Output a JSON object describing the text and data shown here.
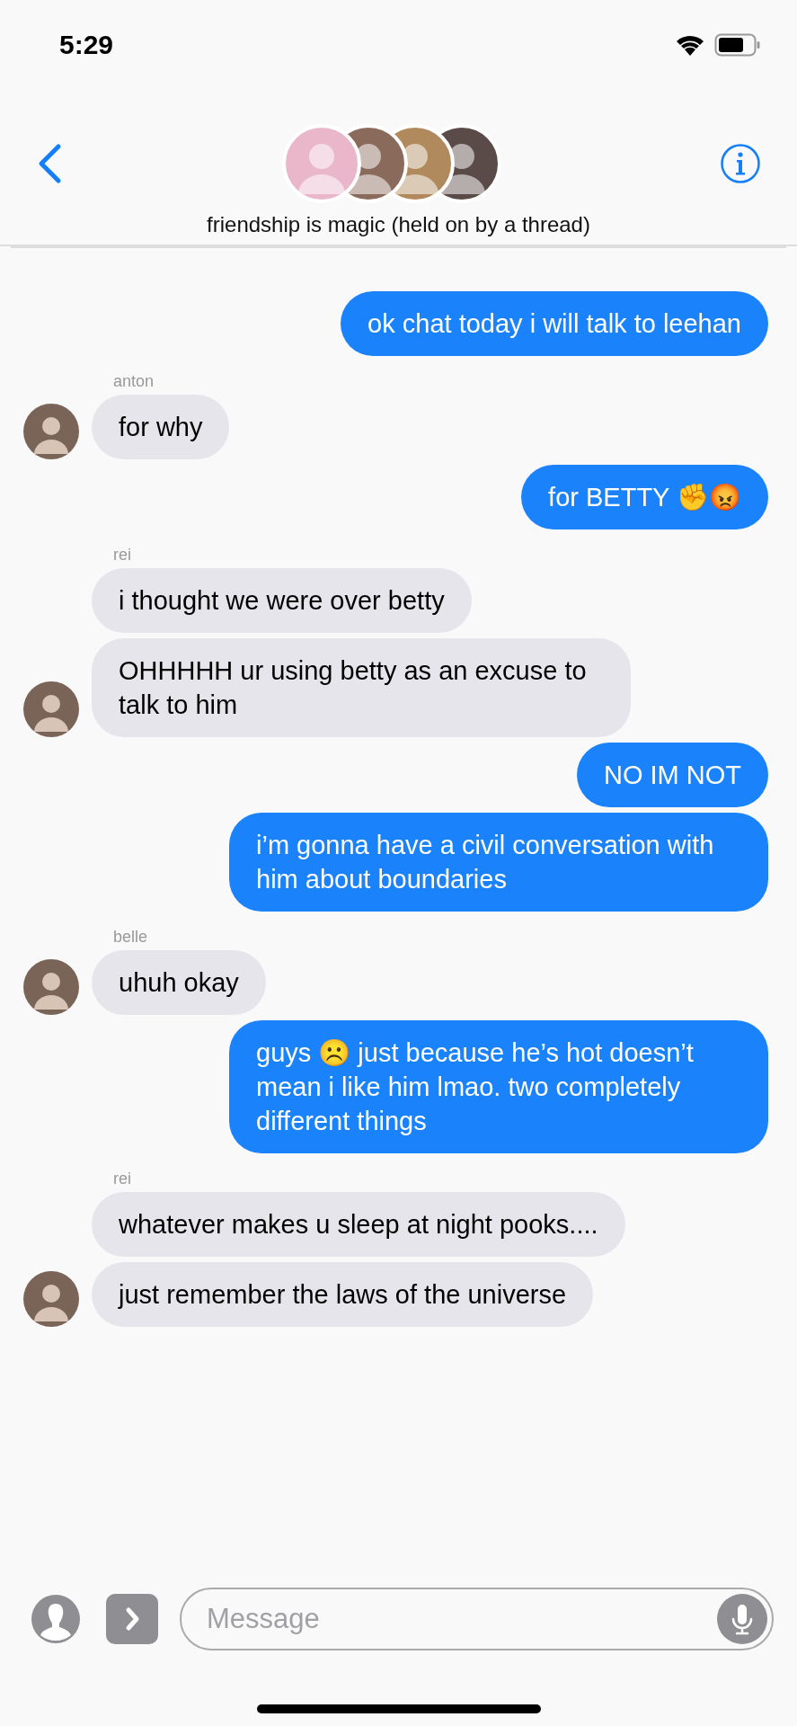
{
  "status_bar": {
    "time": "5:29"
  },
  "header": {
    "title": "friendship is magic (held on by a thread)"
  },
  "messages": [
    {
      "kind": "sent",
      "text": "ok chat today i will talk to leehan"
    },
    {
      "kind": "received",
      "sender": "anton",
      "text": "for why",
      "avatar": true
    },
    {
      "kind": "sent",
      "text": "for BETTY ✊😡"
    },
    {
      "kind": "received",
      "sender": "rei",
      "text": "i thought we were over betty",
      "avatar": false
    },
    {
      "kind": "received",
      "text": "OHHHHH ur using betty as an excuse to talk to him",
      "avatar": true
    },
    {
      "kind": "sent",
      "text": "NO IM NOT"
    },
    {
      "kind": "sent",
      "text": "i’m gonna have a civil conversation with him about boundaries"
    },
    {
      "kind": "received",
      "sender": "belle",
      "text": "uhuh okay",
      "avatar": true
    },
    {
      "kind": "sent",
      "text": "guys ☹️ just because he’s hot doesn’t mean i like him lmao. two completely different things"
    },
    {
      "kind": "received",
      "sender": "rei",
      "text": "whatever makes u sleep at night pooks....",
      "avatar": false
    },
    {
      "kind": "received",
      "text": "just remember the laws of the universe",
      "avatar": true
    }
  ],
  "composer": {
    "placeholder": "Message"
  }
}
